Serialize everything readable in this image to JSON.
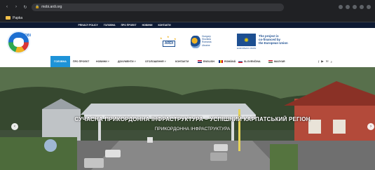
{
  "browser": {
    "url": "mobi.ardi.org",
    "bookmark_folder": "Papka"
  },
  "site": {
    "topbar_links": [
      "PRIVACY POLICY",
      "ГОЛОВНА",
      "ПРО ПРОЕКТ",
      "НОВИНИ",
      "КОНТАКТИ"
    ],
    "logo_text": "MOBI",
    "ardi_text": "ARDI",
    "partnership_text": [
      "Hungary",
      "Slovakia",
      "Romania",
      "Ukraine"
    ],
    "eu_text": [
      "The project is",
      "co-financed by",
      "the European Union"
    ],
    "eu_subtext": "EUROPEAN UNION",
    "menu": [
      {
        "label": "ГОЛОВНА",
        "active": true
      },
      {
        "label": "ПРО ПРОЕКТ",
        "active": false
      },
      {
        "label": "НОВИНИ ˅",
        "active": false
      },
      {
        "label": "ДОКУМЕНТИ ˅",
        "active": false
      },
      {
        "label": "ОГОЛОШЕННЯ ˅",
        "active": false
      },
      {
        "label": "КОНТАКТИ",
        "active": false
      }
    ],
    "languages": [
      {
        "label": "ENGLISH",
        "flag": "gb"
      },
      {
        "label": "ROMÂNĂ",
        "flag": "ro"
      },
      {
        "label": "SLOVENČINA",
        "flag": "sk"
      },
      {
        "label": "MAGYAR",
        "flag": "hu"
      }
    ],
    "social_icons": [
      "facebook-icon",
      "youtube-icon",
      "email-icon",
      "search-icon"
    ],
    "hero": {
      "title": "СУЧАСНА ПРИКОРДОННА ІНФРАСТРУКТУРА – УСПІШНИЙ КАРПАТСЬКИЙ РЕГІОН",
      "subtitle": "ПРИКОРДОННА ІНФРАСТРУКТУРА"
    }
  },
  "colors": {
    "accent": "#1e93d8",
    "topbar": "#0e1a33",
    "eu_blue": "#1d4f91"
  }
}
